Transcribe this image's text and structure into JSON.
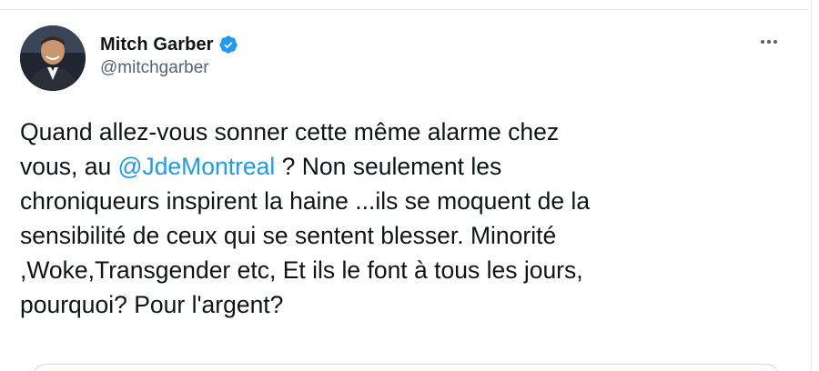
{
  "tweet": {
    "author": {
      "display_name": "Mitch Garber",
      "handle": "@mitchgarber",
      "verified": true
    },
    "body": {
      "before_mention": "Quand allez-vous sonner cette même alarme chez\nvous, au ",
      "mention": "@JdeMontreal",
      "after_mention": " ? Non seulement les\nchroniqueurs inspirent la haine ...ils se moquent de la\nsensibilité de ceux qui se sentent blesser. Minorité\n,Woke,Transgender etc, Et ils le font à tous les jours,\npourquoi? Pour l'argent?"
    }
  },
  "icons": {
    "verified": "verified-badge-icon",
    "more": "more-horizontal-icon"
  },
  "colors": {
    "text": "#0f1419",
    "secondary_text": "#536471",
    "link": "#1d9bf0",
    "verified": "#1d9bf0",
    "divider": "#e6ecf0"
  }
}
